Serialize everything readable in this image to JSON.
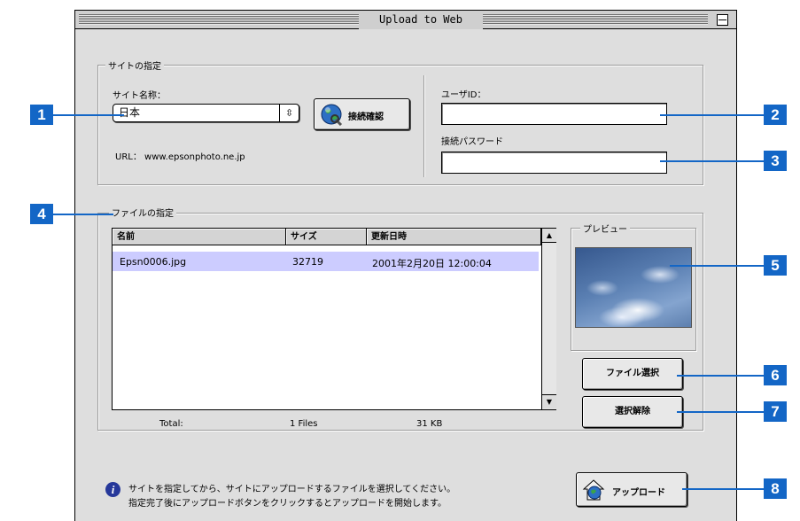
{
  "window": {
    "title": "Upload to Web"
  },
  "site_group": {
    "title": "サイトの指定",
    "site_name_label": "サイト名称：",
    "site_name_value": "日本",
    "connect_button": "接続確認",
    "url_text": "URL： www.epsonphoto.ne.jp",
    "user_id_label": "ユーザID：",
    "user_id_value": "",
    "password_label": "接続パスワード",
    "password_value": ""
  },
  "file_group": {
    "title": "ファイルの指定",
    "columns": [
      "名前",
      "サイズ",
      "更新日時"
    ],
    "rows": [
      {
        "name": "Epsn0006.jpg",
        "size": "32719",
        "date": "2001年2月20日 12:00:04"
      }
    ],
    "total_label": "Total:",
    "total_files": "1 Files",
    "total_size": "31 KB"
  },
  "preview": {
    "title": "プレビュー"
  },
  "buttons": {
    "select_file": "ファイル選択",
    "deselect": "選択解除",
    "upload": "アップロード"
  },
  "info": {
    "line1": "サイトを指定してから、サイトにアップロードするファイルを選択してください。",
    "line2": "指定完了後にアップロードボタンをクリックするとアップロードを開始します。"
  },
  "callouts": [
    "1",
    "2",
    "3",
    "4",
    "5",
    "6",
    "7",
    "8"
  ],
  "colors": {
    "callout": "#1366c6",
    "selection": "#ccccff",
    "window_bg": "#dedede"
  }
}
